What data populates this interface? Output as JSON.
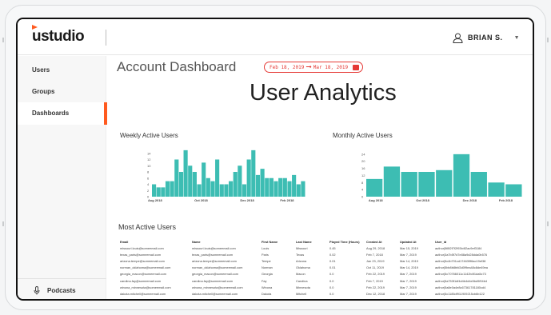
{
  "app": {
    "logo_text": "ustudio",
    "user_label": "BRIAN S."
  },
  "sidebar": {
    "items": [
      {
        "label": "Users"
      },
      {
        "label": "Groups"
      },
      {
        "label": "Dashboards",
        "active": true
      }
    ],
    "podcasts_label": "Podcasts"
  },
  "header": {
    "title": "Account Dashboard",
    "date_from": "Feb 18, 2019",
    "date_to": "Mar 18, 2019",
    "main_title": "User Analytics"
  },
  "colors": {
    "accent": "#ff5a1f",
    "bar": "#3dbdb3",
    "date_range": "#e53935"
  },
  "chart_data": [
    {
      "type": "bar",
      "title": "Weekly Active Users",
      "ylim": [
        0,
        16
      ],
      "yticks": [
        0,
        2,
        4,
        6,
        8,
        10,
        12,
        14
      ],
      "xtick_labels": [
        "Aug 2018",
        "Oct 2018",
        "Dec 2018",
        "Feb 2018"
      ],
      "values": [
        4,
        3,
        3,
        5,
        5,
        12,
        8,
        15,
        10,
        8,
        4,
        11,
        6,
        5,
        12,
        4,
        4,
        5,
        8,
        10,
        4,
        12,
        15,
        7,
        9,
        6,
        6,
        5,
        6,
        6,
        5,
        7,
        4,
        5
      ]
    },
    {
      "type": "bar",
      "title": "Monthly Active Users",
      "ylim": [
        0,
        28
      ],
      "yticks": [
        0,
        4,
        8,
        12,
        16,
        20,
        24
      ],
      "xtick_labels": [
        "Aug 2018",
        "Oct 2018",
        "Dec 2018",
        "Feb 2018"
      ],
      "values": [
        10,
        17,
        14,
        14,
        15,
        24,
        14,
        8,
        7
      ]
    }
  ],
  "most_active": {
    "title": "Most Active Users",
    "columns": [
      "Email",
      "Name",
      "First Name",
      "Last Name",
      "Played Time (Hours)",
      "Created At",
      "Updated At",
      "User_id"
    ],
    "rows": [
      [
        "missouri.louis@someemail.com",
        "missouri.louis@someemail.com",
        "Louis",
        "Missouri",
        "0.45",
        "Aug 29, 2018",
        "Mar 15, 2019",
        "author|5f8f2f7f2f93b4f2ac9ef3184"
      ],
      [
        "texas_paris@someemail.com",
        "texas_paris@someemail.com",
        "Paris",
        "Texas",
        "0.02",
        "Feb 7, 2018",
        "Mar 7, 2019",
        "author|3a7b5f7d7e88a9d28dda0b576"
      ],
      [
        "arizona.tempe@someemail.com",
        "arizona.tempe@someemail.com",
        "Tempe",
        "Arizona",
        "0.01",
        "Jan 23, 2019",
        "Mar 14, 2019",
        "author|5c4b701cd174639f6ac19ef38"
      ],
      [
        "norman_oklahoma@someemail.com",
        "norman_oklahoma@someemail.com",
        "Norman",
        "Oklahoma",
        "0.01",
        "Oct 11, 2019",
        "Mar 14, 2019",
        "author|5bb8b8bfd3d0f9ea48c8de49ea"
      ],
      [
        "georgia_macon@someemail.com",
        "georgia_macon@someemail.com",
        "Georgia",
        "Macon",
        "0.0",
        "Feb 22, 2019",
        "Mar 7, 2019",
        "author|5c70766011c1142b4f1da5c73"
      ],
      [
        "carolina.fay@someemail.com",
        "carolina.fay@someemail.com",
        "Fay",
        "Carolina",
        "0.0",
        "Feb 7, 2019",
        "Mar 7, 2019",
        "author|5a753f1df4d4b4d4e5bd9f04b4"
      ],
      [
        "winona_minnesota@someemail.com",
        "winona_minnesota@someemail.com",
        "Winona",
        "Minnesota",
        "0.0",
        "Feb 22, 2019",
        "Mar 7, 2019",
        "author|5a8e0a4e8c67361781180cd4"
      ],
      [
        "dakota.mitchell@someemail.com",
        "dakota.mitchell@someemail.com",
        "Dakota",
        "Mitchell",
        "0.0",
        "Dec 12, 2018",
        "Mar 7, 2019",
        "author|5c1185df911909215cb6b122"
      ]
    ]
  }
}
